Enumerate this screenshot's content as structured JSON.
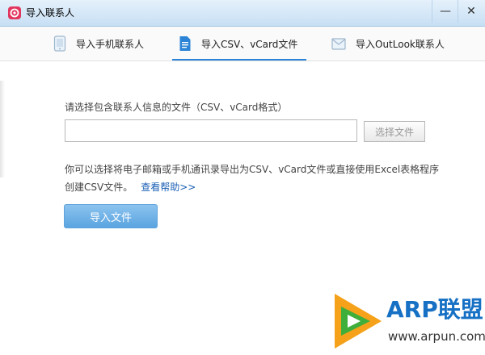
{
  "window": {
    "title": "导入联系人",
    "minimize_glyph": "—",
    "close_glyph": "✕"
  },
  "tabs": [
    {
      "label": "导入手机联系人",
      "icon": "phone-icon",
      "active": false
    },
    {
      "label": "导入CSV、vCard文件",
      "icon": "document-icon",
      "active": true
    },
    {
      "label": "导入OutLook联系人",
      "icon": "mail-icon",
      "active": false
    }
  ],
  "form": {
    "prompt": "请选择包含联系人信息的文件（CSV、vCard格式）",
    "file_value": "",
    "choose_label": "选择文件",
    "description_line1": "你可以选择将电子邮箱或手机通讯录导出为CSV、vCard文件或直接使用Excel表格程序",
    "description_line2": "创建CSV文件。",
    "help_link": "查看帮助>>",
    "import_label": "导入文件"
  },
  "watermark": {
    "brand": "ARP联盟",
    "url": "www.arpun.com"
  },
  "colors": {
    "accent": "#2b84d6",
    "import_button": "#5aa4e0",
    "link": "#1a5fb4"
  }
}
